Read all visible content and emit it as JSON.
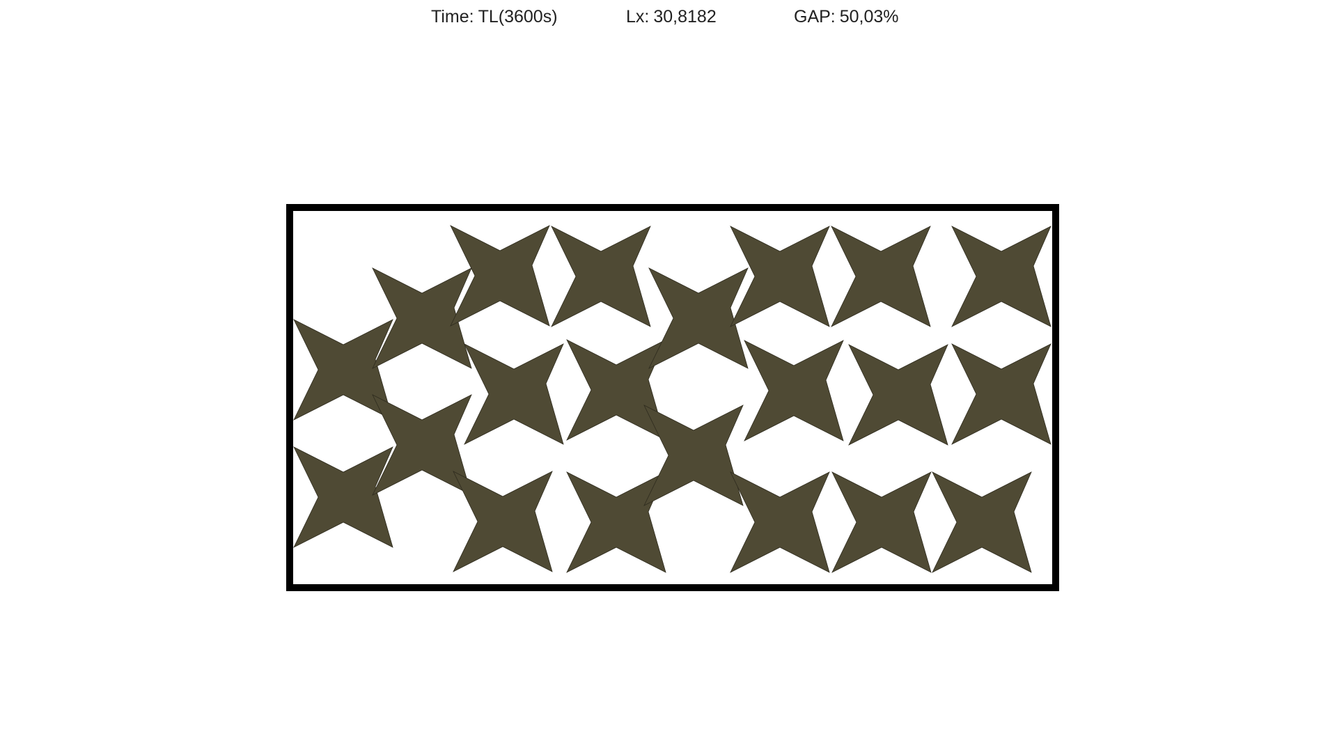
{
  "header": {
    "time_label": "Time:",
    "time_value": "TL(3600s)",
    "lx_label": "Lx:",
    "lx_value": "30,8182",
    "gap_label": "GAP:",
    "gap_value": "50,03%"
  },
  "colors": {
    "piece_fill": "#4f4a34",
    "container_border": "#000000",
    "background": "#ffffff"
  }
}
